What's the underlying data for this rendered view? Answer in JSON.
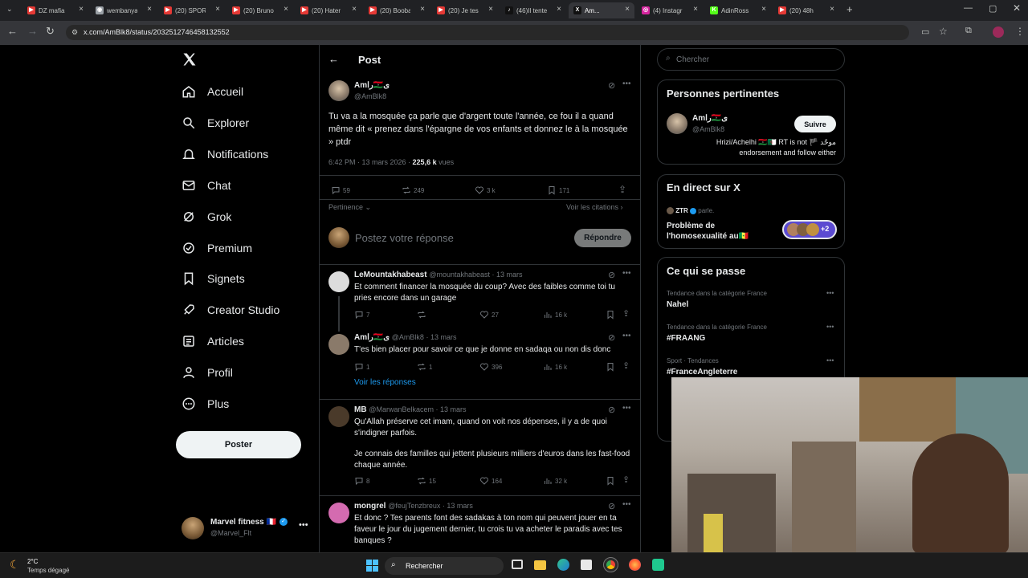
{
  "browser": {
    "tabs": [
      {
        "label": "DZ mafia",
        "color": "#e53935",
        "glyph": "▶"
      },
      {
        "label": "wembanyama",
        "color": "#9aa0a6",
        "glyph": "◉"
      },
      {
        "label": "(20) SPOR",
        "color": "#e53935",
        "glyph": "▶"
      },
      {
        "label": "(20) Bruno",
        "color": "#e53935",
        "glyph": "▶"
      },
      {
        "label": "(20) Hater",
        "color": "#e53935",
        "glyph": "▶"
      },
      {
        "label": "(20) Booba",
        "color": "#e53935",
        "glyph": "▶"
      },
      {
        "label": "(20) Je tes",
        "color": "#e53935",
        "glyph": "▶"
      },
      {
        "label": "(46)Il tente",
        "color": "#111111",
        "glyph": "♪"
      },
      {
        "label": "Am...",
        "color": "#111111",
        "glyph": "X"
      },
      {
        "label": "(4) Instagr",
        "color": "#d6249f",
        "glyph": "◎"
      },
      {
        "label": "AdinRoss",
        "color": "#53fc18",
        "glyph": "K"
      },
      {
        "label": "(20) 48h",
        "color": "#e53935",
        "glyph": "▶"
      }
    ],
    "active_tab_index": 8,
    "url": "x.com/AmBlk8/status/2032512746458132552"
  },
  "nav": {
    "items": [
      {
        "label": "Accueil",
        "icon": "home-icon"
      },
      {
        "label": "Explorer",
        "icon": "search-icon"
      },
      {
        "label": "Notifications",
        "icon": "bell-icon"
      },
      {
        "label": "Chat",
        "icon": "mail-icon"
      },
      {
        "label": "Grok",
        "icon": "grok-icon"
      },
      {
        "label": "Premium",
        "icon": "premium-icon"
      },
      {
        "label": "Signets",
        "icon": "bookmark-icon"
      },
      {
        "label": "Creator Studio",
        "icon": "rocket-icon"
      },
      {
        "label": "Articles",
        "icon": "article-icon"
      },
      {
        "label": "Profil",
        "icon": "person-icon"
      },
      {
        "label": "Plus",
        "icon": "more-circle-icon"
      }
    ],
    "post_button": "Poster",
    "account": {
      "name": "Marvel fitness 🇫🇷",
      "handle": "@Marvel_Flt"
    }
  },
  "post": {
    "header_title": "Post",
    "author": {
      "name": "Amرا🇱🇾ى",
      "handle": "@AmBlk8"
    },
    "text": "Tu va a la mosquée ça parle que d'argent toute l'année, ce fou il a quand même dit « prenez dans l'épargne de vos enfants et donnez le à la mosquée » ptdr",
    "time": "6:42 PM · 13 mars 2026 · ",
    "views_count": "225,6 k",
    "views_label": " vues",
    "stats": {
      "replies": "59",
      "reposts": "249",
      "likes": "3 k",
      "bookmarks": "171"
    },
    "sort_label": "Pertinence",
    "quotes_link": "Voir les citations",
    "reply_placeholder": "Postez votre réponse",
    "reply_button": "Répondre"
  },
  "replies": [
    {
      "name": "LeMountakhabeast",
      "handle": "@mountakhabeast · 13 mars",
      "text": "Et comment financer la mosquée du coup? Avec des faibles comme toi tu pries encore dans un garage",
      "replies": "7",
      "reposts": "",
      "likes": "27",
      "views": "16 k"
    },
    {
      "name": "Amرا🇱🇾ى",
      "handle": "@AmBlk8 · 13 mars",
      "text": "T'es bien placer pour savoir ce que je donne en sadaqa ou non dis donc",
      "replies": "1",
      "reposts": "1",
      "likes": "396",
      "views": "16 k",
      "show_replies": "Voir les réponses"
    },
    {
      "name": "MB",
      "handle": "@MarwanBelkacem · 13 mars",
      "text": "Qu'Allah préserve cet imam, quand on voit nos dépenses, il y a de quoi s'indigner parfois.",
      "text2": "Je connais des familles qui jettent plusieurs milliers d'euros dans les fast-food chaque année.",
      "replies": "8",
      "reposts": "15",
      "likes": "164",
      "views": "32 k"
    },
    {
      "name": "mongrel",
      "handle": "@feujTenzbreux · 13 mars",
      "text": "Et donc ? Tes parents font des sadakas à ton nom qui peuvent jouer en ta faveur le jour du jugement dernier, tu crois tu va acheter le paradis avec tes banques ?"
    }
  ],
  "sidebar": {
    "search_placeholder": "Chercher",
    "relevant": {
      "title": "Personnes pertinentes",
      "name": "Amرا🇱🇾ى",
      "handle": "@AmBlk8",
      "follow": "Suivre",
      "bio1": "Hrizi/Achelhi 🇱🇾🇩🇿 RT is not 🏴 موحّد",
      "bio2": "endorsement and follow either"
    },
    "live": {
      "title": "En direct sur X",
      "host": "ZTR",
      "speaking": "parle.",
      "topic1": "Problème de",
      "topic2": "l'homosexualité au🇸🇳",
      "extra": "+2"
    },
    "trends": {
      "title": "Ce qui se passe",
      "items": [
        {
          "category": "Tendance dans la catégorie France",
          "name": "Nahel"
        },
        {
          "category": "Tendance dans la catégorie France",
          "name": "#FRAANG"
        },
        {
          "category": "Sport · Tendances",
          "name": "#FranceAngleterre"
        }
      ]
    }
  },
  "taskbar": {
    "temp": "2°C",
    "weather": "Temps dégagé",
    "search": "Rechercher"
  }
}
